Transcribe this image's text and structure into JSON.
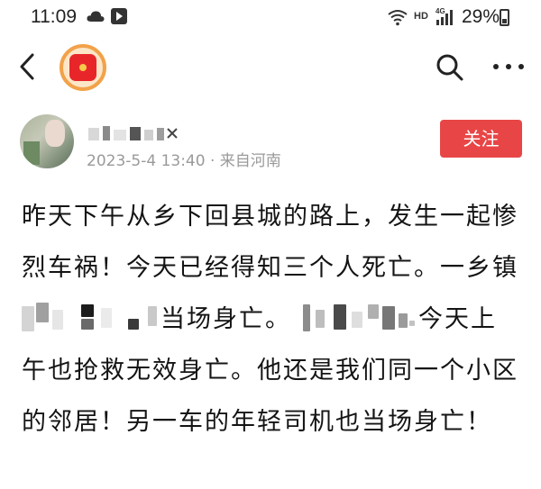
{
  "status_bar": {
    "time": "11:09",
    "hd_label": "HD",
    "network": "4G",
    "battery_percent": "29%"
  },
  "top_bar": {
    "back_icon": "chevron-left-icon",
    "logo_icon": "red-envelope-icon",
    "search_icon": "search-icon",
    "more_icon": "more-horizontal-icon"
  },
  "author": {
    "meta": "2023-5-4 13:40 · 来自河南",
    "follow_label": "关注"
  },
  "post": {
    "line1": "昨天下午从乡下回县城的路上，发生一起惨",
    "line2": "烈车祸！今天已经得知三个人死亡。一乡镇",
    "line3_a": "当场身亡。",
    "line3_b": "今天上",
    "line4": "午也抢救无效身亡。他还是我们同一个小区",
    "line5": "的邻居！另一车的年轻司机也当场身亡！"
  },
  "colors": {
    "follow_button": "#e84646",
    "meta_text": "#9a9a9a",
    "body_text": "#141414"
  }
}
